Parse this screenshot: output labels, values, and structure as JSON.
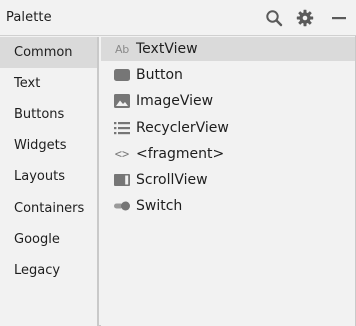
{
  "header": {
    "title": "Palette",
    "icons": [
      "search-icon",
      "gear-icon",
      "minimize-icon"
    ]
  },
  "categories": [
    {
      "label": "Common",
      "selected": true
    },
    {
      "label": "Text",
      "selected": false
    },
    {
      "label": "Buttons",
      "selected": false
    },
    {
      "label": "Widgets",
      "selected": false
    },
    {
      "label": "Layouts",
      "selected": false
    },
    {
      "label": "Containers",
      "selected": false
    },
    {
      "label": "Google",
      "selected": false
    },
    {
      "label": "Legacy",
      "selected": false
    }
  ],
  "items": [
    {
      "label": "TextView",
      "icon": "textview-icon",
      "icon_text": "Ab",
      "selected": true
    },
    {
      "label": "Button",
      "icon": "button-icon",
      "selected": false
    },
    {
      "label": "ImageView",
      "icon": "image-icon",
      "selected": false
    },
    {
      "label": "RecyclerView",
      "icon": "list-icon",
      "selected": false
    },
    {
      "label": "<fragment>",
      "icon": "code-brackets-icon",
      "icon_text": "<>",
      "selected": false
    },
    {
      "label": "ScrollView",
      "icon": "scrollview-icon",
      "selected": false
    },
    {
      "label": "Switch",
      "icon": "switch-icon",
      "selected": false
    }
  ],
  "colors": {
    "background": "#f2f2f2",
    "selected": "#dadada",
    "icon": "#6e6e6e",
    "divider": "#c9c9c9"
  }
}
